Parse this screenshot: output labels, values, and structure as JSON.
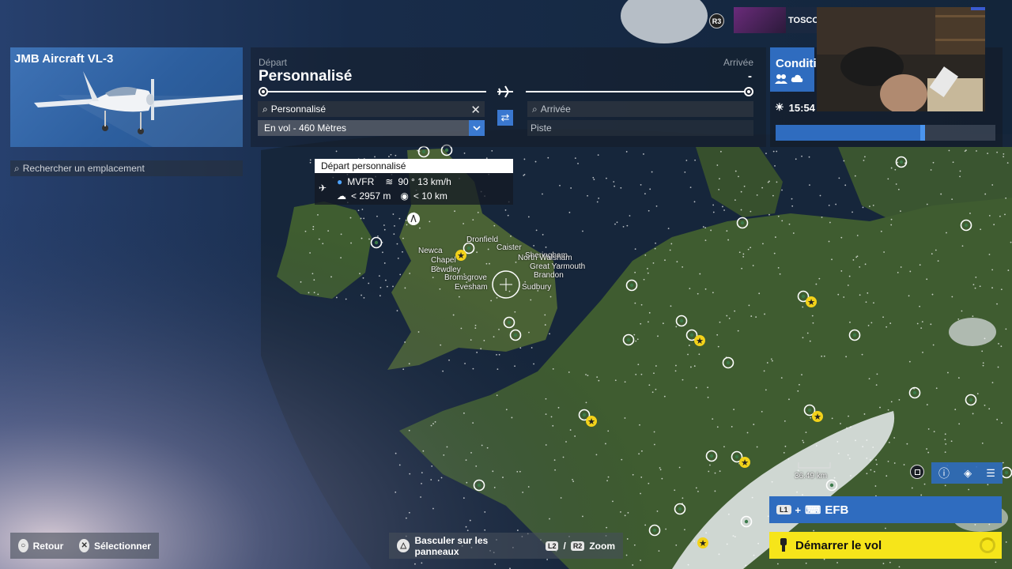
{
  "aircraft": {
    "name": "JMB Aircraft VL-3"
  },
  "location_search": {
    "placeholder": "Rechercher un emplacement"
  },
  "planner": {
    "departure_label": "Départ",
    "departure_name": "Personnalisé",
    "arrival_label": "Arrivée",
    "arrival_value": "-",
    "departure_search_value": "Personnalisé",
    "departure_altitude": "En vol - 460 Mètres",
    "arrival_search_placeholder": "Arrivée",
    "arrival_runway_placeholder": "Piste"
  },
  "conditions": {
    "title": "Conditi",
    "time": "15:54",
    "time_progress": 0.66
  },
  "stream": {
    "name": "TOSCO",
    "badge": "R3"
  },
  "popup": {
    "title": "Départ personnalisé",
    "flight_rules": "MVFR",
    "wind": "90 ° 13 km/h",
    "ceiling": "< 2957  m",
    "visibility": "< 10  km"
  },
  "map": {
    "city_labels": [
      "Newca",
      "Dronfield",
      "Sheringham",
      "North Walsham",
      "Great Yarmouth",
      "Brandon",
      "Bromsgrove",
      "Evesham",
      "Sudbury",
      "Chapel",
      "Bewdley",
      "Caister"
    ],
    "scale_label": "36.49 km",
    "colors": {
      "sea": "#16263b",
      "land": "#3d5a2e",
      "airport": "#ffffff",
      "major_airport": "#f3d21a"
    }
  },
  "buttons": {
    "efb_key": "L1",
    "efb_label": "EFB",
    "start_flight": "Démarrer le vol",
    "back": "Retour",
    "select": "Sélectionner",
    "toggle_panels": "Basculer sur les panneaux",
    "zoom_key_l": "L2",
    "zoom_separator": "/",
    "zoom_key_r": "R2",
    "zoom": "Zoom"
  }
}
